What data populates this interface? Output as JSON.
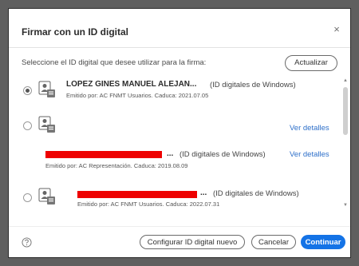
{
  "dialog": {
    "title": "Firmar con un ID digital",
    "close_glyph": "×",
    "instruction": "Seleccione el ID digital que desee utilizar para la firma:",
    "refresh_label": "Actualizar"
  },
  "ids": [
    {
      "name": "LOPEZ GINES MANUEL ALEJAN...",
      "type": "(ID digitales de Windows)",
      "issuer": "Emitido por: AC FNMT Usuarios. Caduca: 2021.07.05",
      "selected": true
    },
    {
      "details_label": "Ver detalles",
      "selected": false
    },
    {
      "ellipsis": "...",
      "type": "(ID digitales de Windows)",
      "issuer": "Emitido por: AC Representación. Caduca: 2019.08.09",
      "details_label": "Ver detalles"
    },
    {
      "ellipsis": "...",
      "type": "(ID digitales de Windows)",
      "issuer": "Emitido por: AC FNMT Usuarios. Caduca: 2022.07.31",
      "selected": false
    }
  ],
  "footer": {
    "help_icon": "help-icon",
    "configure_label": "Configurar ID digital nuevo",
    "cancel_label": "Cancelar",
    "continue_label": "Continuar"
  },
  "colors": {
    "accent": "#1473e6",
    "link": "#2d6fc9",
    "redaction": "#ee0000"
  },
  "icons": {
    "certificate": "certificate-icon",
    "close": "close-icon"
  }
}
